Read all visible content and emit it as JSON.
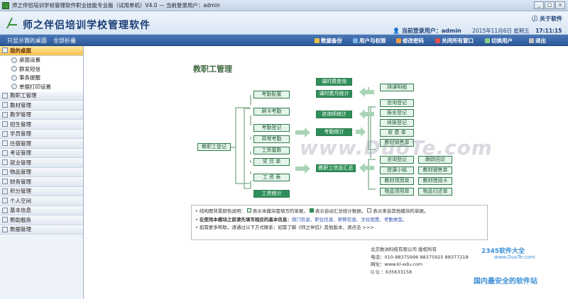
{
  "window": {
    "title": "师之伴侣培训学校管理软件职业技能专业版（试用单机）V4.0 — 当前登录用户：admin"
  },
  "header": {
    "app_title": "师之伴侣培训学校管理软件",
    "about": "关于软件",
    "current_user": "当前登录用户：admin",
    "date": "2015年11月6日",
    "weekday": "星期五",
    "time": "17:11:15"
  },
  "toolbar": {
    "show_desktop": "只显示我的桌面",
    "expand_all": "全部折叠",
    "backup": "数据备份",
    "users": "用户与权限",
    "change_pwd": "修改密码",
    "close_all": "关闭所有窗口",
    "switch_user": "切换用户",
    "logout": "退出"
  },
  "sidebar": {
    "desktop_section": "我的桌面",
    "desktop_items": [
      "桌面设置",
      "群发短信",
      "事务提醒",
      "单据打印设置"
    ],
    "sections": [
      "教职工管理",
      "教材管理",
      "教学管理",
      "招生管理",
      "学员管理",
      "住宿管理",
      "考证管理",
      "就业管理",
      "物品管理",
      "财务管理",
      "积分管理",
      "个人空间",
      "基本信息",
      "帮助服务",
      "数据管理"
    ]
  },
  "diagram": {
    "title": "教职工管理",
    "attendance_config": "考勤配置",
    "card_attendance": "刷卡考勤",
    "attendance_register": "考勤登记",
    "abnormal_attendance": "异常考勤",
    "salary_base": "工资基数",
    "reward_punish": "奖 罚 单",
    "salary_sheet": "工 资 表",
    "salary_stats": "工资统计",
    "staff_register": "教职工登记",
    "attendance_stats": "考勤统计",
    "staff_info_summary": "教职工信息汇总",
    "class_fee_query": "课时费查询",
    "class_fee_stats": "课时费月统计",
    "schedule": "排课明细",
    "consultant_stats": "咨询师统计",
    "consult_register": "咨询登记",
    "enroll_register": "报名登记",
    "continue_register": "续报登记",
    "receipt": "收 费 单",
    "material_sales": "教材销售单",
    "consult_register2": "咨询登记",
    "follow_return": "跟踪回访",
    "teaching_notes": "授课小结",
    "material_sales2": "教材销售单",
    "material_receive": "教材领用单",
    "material_return": "教材借阅卡",
    "goods_receive": "物品领用单",
    "goods_return": "物品归还单"
  },
  "notes": {
    "line1_prefix": "结构图背景颜色说明：",
    "line1_a": "表示本模块需填写的单据，",
    "line1_b": "表示自动汇总统计数据，",
    "line1_c": "表示来自其他模块的单据。",
    "line2_prefix": "在使用本模块之前请先填写相应的基本信息：",
    "line2_links": "部门信息、职位信息、职称信息、文化程度、考勤类型。",
    "line3": "如需更多帮助，请通过以下方式联系：如需了解《师之伴侣》其他版本，请点击 >>>"
  },
  "company": {
    "name": "北京数洲科技有限公司  版权所有",
    "phone": "电话：010-88375996 88375925 88377218",
    "website": "网址：www.kl-edu.com",
    "qq": "Q Q ：635633158"
  },
  "watermarks": {
    "center": "www.DuoTe.com",
    "brand": "2345软件大全",
    "brand_url": "www.DuoTe.com",
    "tagline": "国内最安全的软件站"
  },
  "colors": {
    "dark_box": "#2f8f5a",
    "light_box": "#e5f4ea",
    "nav": "#2c5897",
    "active_section": "#f6c24a"
  }
}
